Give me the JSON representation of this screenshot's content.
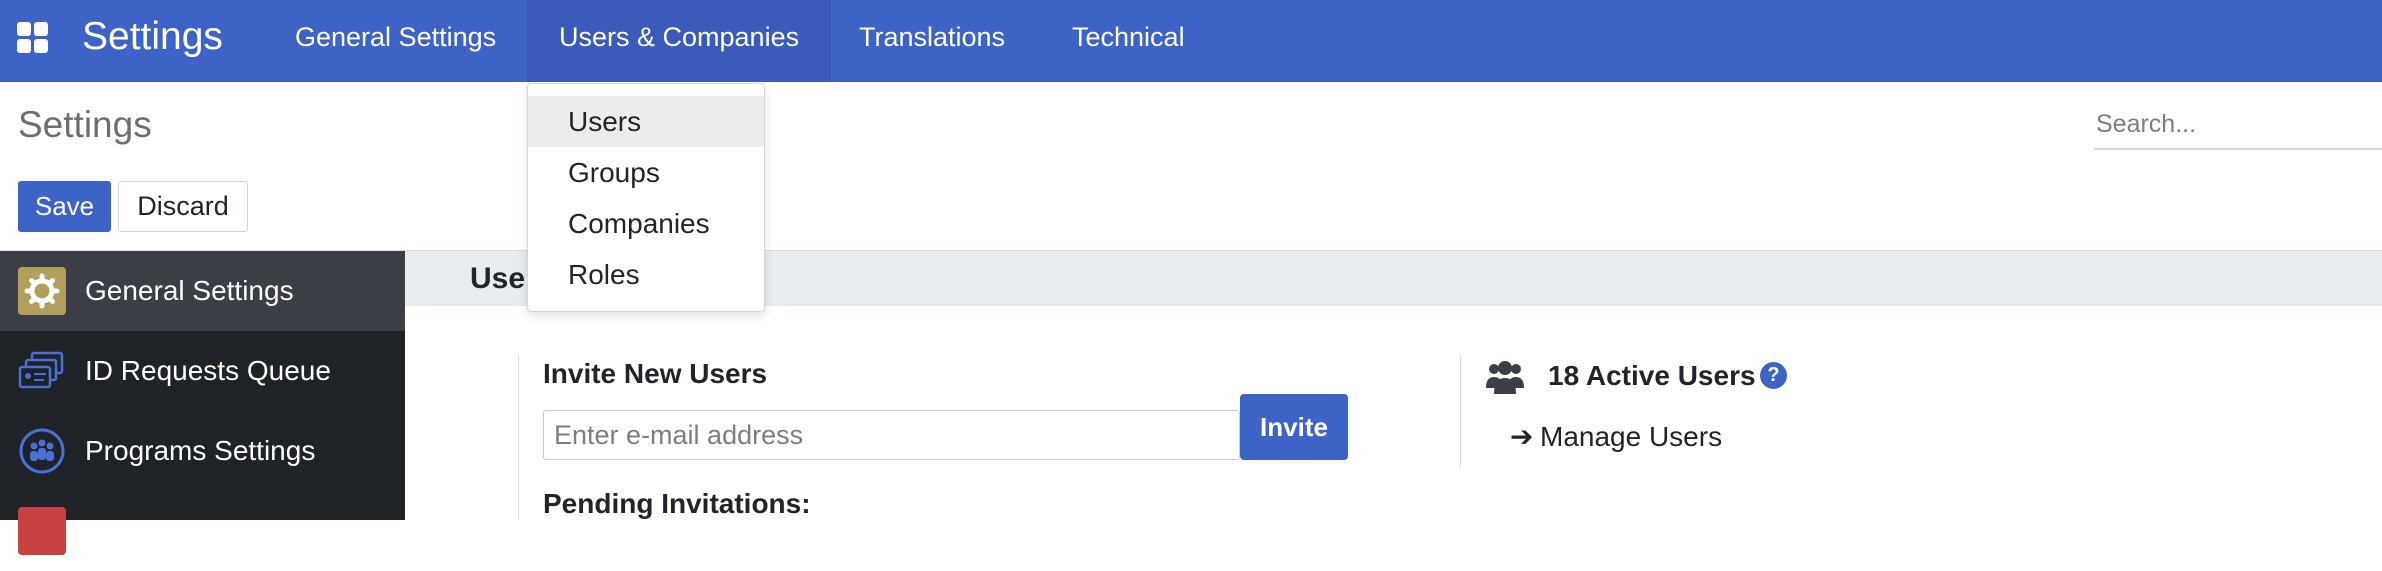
{
  "navbar": {
    "brand": "Settings",
    "menus": [
      "General Settings",
      "Users & Companies",
      "Translations",
      "Technical"
    ],
    "active_menu": "Users & Companies",
    "color": "#3e63c6"
  },
  "dropdown": {
    "items": [
      "Users",
      "Groups",
      "Companies",
      "Roles"
    ],
    "highlighted": "Users"
  },
  "control_panel": {
    "breadcrumb": "Settings",
    "search_placeholder": "Search...",
    "save_label": "Save",
    "discard_label": "Discard"
  },
  "sidebar": {
    "items": [
      {
        "label": "General Settings",
        "icon": "gear-icon",
        "active": true
      },
      {
        "label": "ID Requests Queue",
        "icon": "id-cards-icon",
        "active": false
      },
      {
        "label": "Programs Settings",
        "icon": "people-circle-icon",
        "active": false
      },
      {
        "label": "",
        "icon": "app-icon",
        "active": false
      }
    ]
  },
  "main": {
    "section_title": "Users",
    "invite": {
      "title": "Invite New Users",
      "email_placeholder": "Enter e-mail address",
      "button_label": "Invite"
    },
    "pending_label": "Pending Invitations:",
    "active_users_label": "18 Active Users",
    "help_glyph": "?",
    "manage_users_label": "Manage Users"
  }
}
